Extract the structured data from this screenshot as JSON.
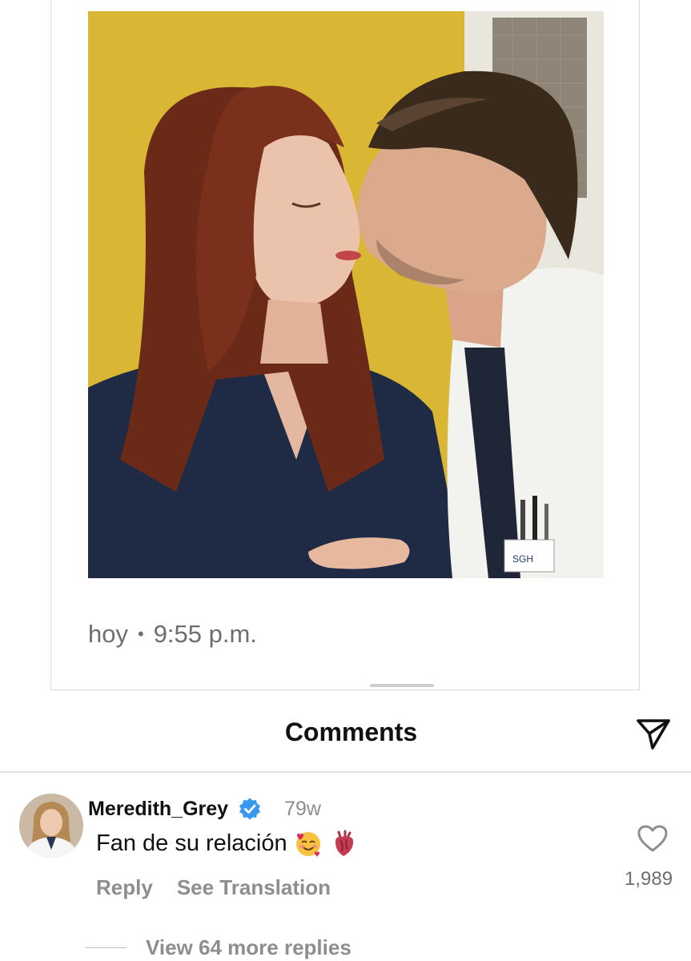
{
  "post": {
    "image_description_icon": "photo-couple-kiss",
    "meta_day": "hoy",
    "meta_separator": "•",
    "meta_time": "9:55 p.m."
  },
  "comments_header": {
    "title": "Comments",
    "share_icon": "send-icon"
  },
  "comment": {
    "username": "Meredith_Grey",
    "verified_icon": "verified-badge-icon",
    "timestamp": "79w",
    "text": "Fan de su relación",
    "emojis": [
      "smiling-face-with-hearts-emoji",
      "anatomical-heart-emoji"
    ],
    "reply_label": "Reply",
    "translate_label": "See Translation",
    "like_icon": "heart-outline-icon",
    "like_count": "1,989",
    "view_replies_label": "View 64 more replies"
  },
  "colors": {
    "verified_blue": "#3897f0",
    "muted_text": "#8e8e8e",
    "photo_wall_yellow": "#d6b331"
  }
}
